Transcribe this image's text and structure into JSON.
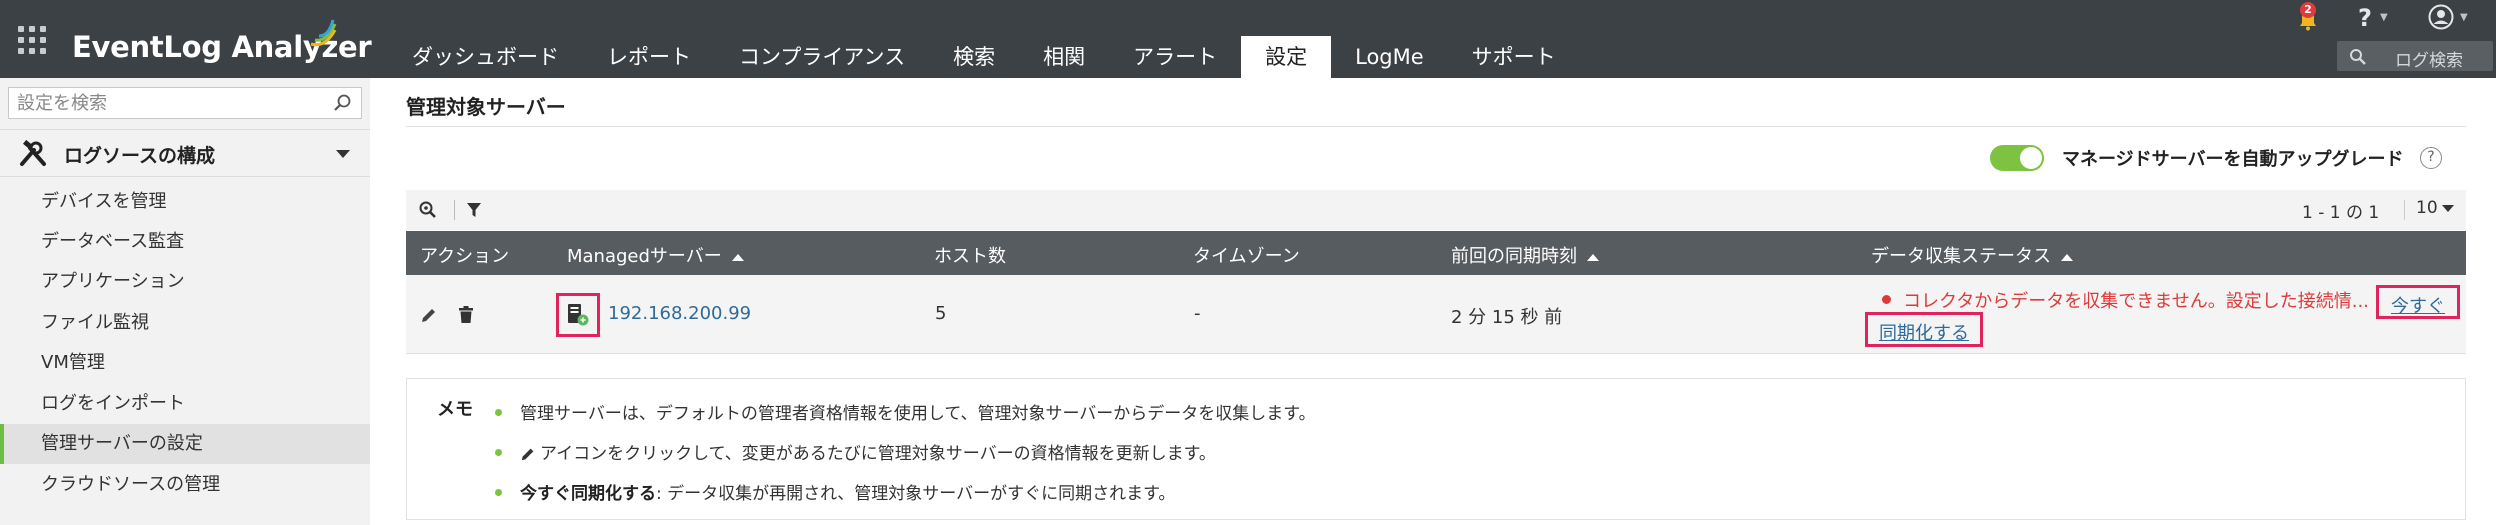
{
  "app": {
    "brand": "EventLog Analyzer",
    "notification_count": "2",
    "help_glyph": "?",
    "log_search_placeholder": "ログ検索"
  },
  "tabs": [
    {
      "label": "ダッシュボード",
      "active": false
    },
    {
      "label": "レポート",
      "active": false
    },
    {
      "label": "コンプライアンス",
      "active": false
    },
    {
      "label": "検索",
      "active": false
    },
    {
      "label": "相関",
      "active": false
    },
    {
      "label": "アラート",
      "active": false
    },
    {
      "label": "設定",
      "active": true
    },
    {
      "label": "LogMe",
      "active": false
    },
    {
      "label": "サポート",
      "active": false
    }
  ],
  "sidebar": {
    "search_placeholder": "設定を検索",
    "section_label": "ログソースの構成",
    "items": [
      {
        "label": "デバイスを管理",
        "active": false
      },
      {
        "label": "データベース監査",
        "active": false
      },
      {
        "label": "アプリケーション",
        "active": false
      },
      {
        "label": "ファイル監視",
        "active": false
      },
      {
        "label": "VM管理",
        "active": false
      },
      {
        "label": "ログをインポート",
        "active": false
      },
      {
        "label": "管理サーバーの設定",
        "active": true
      },
      {
        "label": "クラウドソースの管理",
        "active": false
      }
    ]
  },
  "main": {
    "title": "管理対象サーバー",
    "auto_upgrade_label": "マネージドサーバーを自動アップグレード",
    "auto_upgrade_enabled": true,
    "help_glyph": "?",
    "pagination": "1 - 1 の 1",
    "per_page": "10",
    "table": {
      "headers": [
        "アクション",
        "Managedサーバー",
        "ホスト数",
        "タイムゾーン",
        "前回の同期時刻",
        "データ収集ステータス"
      ],
      "rows": [
        {
          "server": "192.168.200.99",
          "hosts": "5",
          "timezone": "-",
          "last_sync": "2 分 15 秒 前",
          "status": "コレクタからデータを収集できません。設定した接続情...",
          "sync_now_label": "今すぐ",
          "sync_label": "同期化する"
        }
      ]
    },
    "memo": {
      "title": "メモ",
      "line1": "管理サーバーは、デフォルトの管理者資格情報を使用して、管理対象サーバーからデータを収集します。",
      "line2": "アイコンをクリックして、変更があるたびに管理対象サーバーの資格情報を更新します。",
      "line3_bold": "今すぐ同期化する",
      "line3_rest": ": データ収集が再開され、管理対象サーバーがすぐに同期されます。"
    }
  },
  "colors": {
    "topbar": "#3c4146",
    "accent_green": "#7dc241",
    "table_header": "#575c61",
    "link": "#2e6a9a",
    "error": "#dd3b3b",
    "highlight": "#e0245e"
  }
}
